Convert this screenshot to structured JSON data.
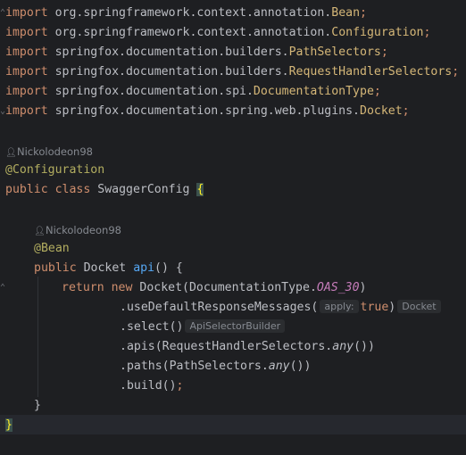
{
  "imports": [
    {
      "prefix": "org.springframework.context.annotation.",
      "name": "Bean"
    },
    {
      "prefix": "org.springframework.context.annotation.",
      "name": "Configuration"
    },
    {
      "prefix": "springfox.documentation.builders.",
      "name": "PathSelectors"
    },
    {
      "prefix": "springfox.documentation.builders.",
      "name": "RequestHandlerSelectors"
    },
    {
      "prefix": "springfox.documentation.spi.",
      "name": "DocumentationType"
    },
    {
      "prefix": "springfox.documentation.spring.web.plugins.",
      "name": "Docket"
    }
  ],
  "keywords": {
    "import": "import",
    "public": "public",
    "class": "class",
    "return": "return",
    "new": "new",
    "true": "true"
  },
  "class_author": "Nickolodeon98",
  "method_author": "Nickolodeon98",
  "class_annotation": "@Configuration",
  "class_name": "SwaggerConfig",
  "method_annotation": "@Bean",
  "method_return_type": "Docket",
  "method_name": "api",
  "ctor_class": "Docket",
  "doc_type_class": "DocumentationType",
  "doc_type_const": "OAS_30",
  "chain": {
    "m1": "useDefaultResponseMessages",
    "m1_param_hint": "apply:",
    "m1_type_hint": "Docket",
    "m2": "select",
    "m2_type_hint": "ApiSelectorBuilder",
    "m3": "apis",
    "m3_class": "RequestHandlerSelectors",
    "m3_method": "any",
    "m4": "paths",
    "m4_class": "PathSelectors",
    "m4_method": "any",
    "m5": "build"
  }
}
